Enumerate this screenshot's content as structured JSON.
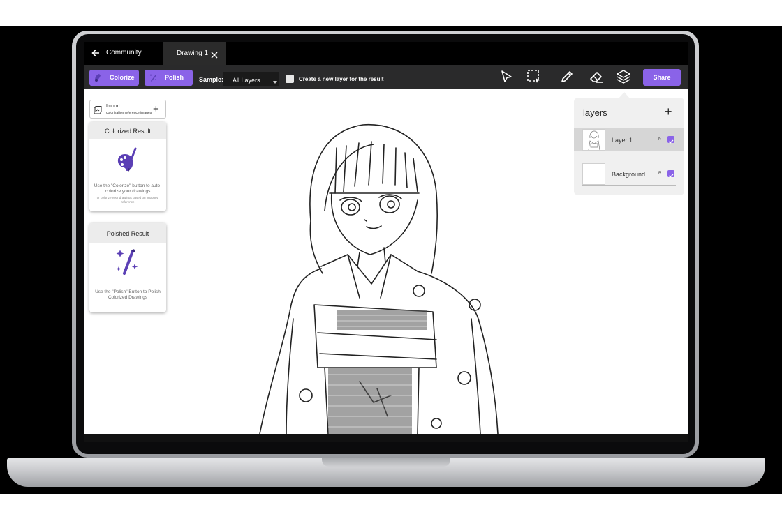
{
  "app": {
    "nav_back_label": "Community",
    "tab_title": "Drawing 1"
  },
  "toolbar": {
    "colorize_label": "Colorize",
    "polish_label": "Polish",
    "sample_label": "Sample:",
    "sample_value": "All Layers",
    "create_layer_label": "Create a new layer for the result",
    "create_layer_checked": false,
    "share_label": "Share",
    "accent_color": "#8a63e8",
    "tools": [
      "select-arrow-icon",
      "lasso-select-icon",
      "pen-icon",
      "eraser-icon",
      "layers-icon"
    ]
  },
  "import": {
    "title": "Import",
    "subtitle": "colorization reference images"
  },
  "colorized_card": {
    "title": "Colorized Result",
    "description": "Use the \"Colorize\" button to auto-colorize your drawings",
    "description_small": "or colorize your drawings based on imported reference"
  },
  "polished_card": {
    "title": "Poished Result",
    "description": "Use the \"Polish\" Button to Polish Colorized Drawings"
  },
  "layers_panel": {
    "title": "layers",
    "items": [
      {
        "name": "Layer 1",
        "mode": "N",
        "visible": true,
        "selected": true
      },
      {
        "name": "Background",
        "mode": "B",
        "visible": true,
        "selected": false
      }
    ]
  }
}
